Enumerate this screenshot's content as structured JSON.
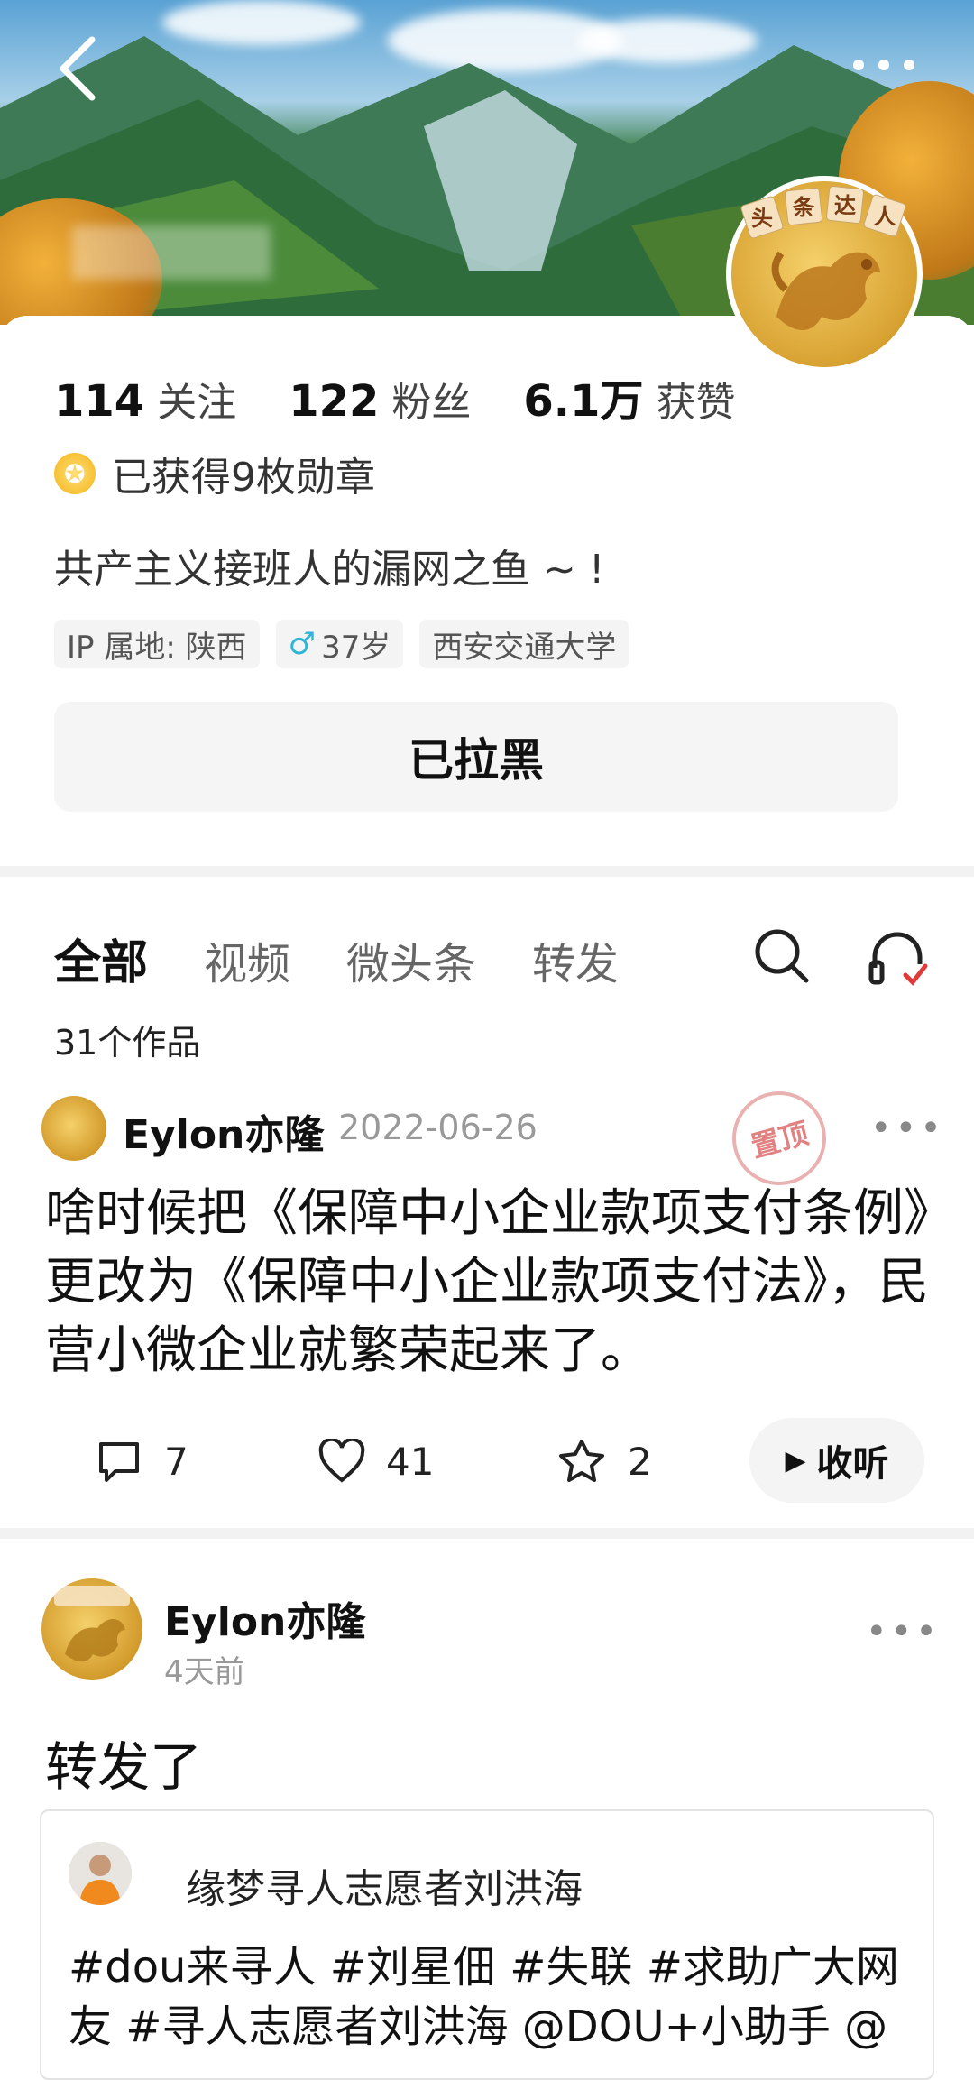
{
  "header": {
    "back_icon": "chevron-left-icon",
    "more_icon": "more-dots-icon",
    "avatar_badge_text": "头条达人"
  },
  "profile": {
    "stats": [
      {
        "num": "114",
        "label": "关注"
      },
      {
        "num": "122",
        "label": "粉丝"
      },
      {
        "num": "6.1万",
        "label": "获赞"
      }
    ],
    "badges_text": "已获得9枚勋章",
    "bio": "共产主义接班人的漏网之鱼 ~ !",
    "tags": [
      "IP 属地: 陕西",
      "37岁",
      "西安交通大学"
    ],
    "gender_icon": "male-icon",
    "blocked_label": "已拉黑"
  },
  "tabs": {
    "items": [
      "全部",
      "视频",
      "微头条",
      "转发"
    ],
    "active": "全部",
    "works_count": "31个作品"
  },
  "posts": [
    {
      "author": "Eylon亦隆",
      "date": "2022-06-26",
      "pin_label": "置顶",
      "text": "啥时候把《保障中小企业款项支付条例》更改为《保障中小企业款项支付法》，民营小微企业就繁荣起来了。",
      "comments": "7",
      "likes": "41",
      "favorites": "2",
      "listen_label": "收听"
    },
    {
      "author": "Eylon亦隆",
      "date": "4天前",
      "text": "转发了",
      "quote": {
        "author": "缘梦寻人志愿者刘洪海",
        "text": "#dou来寻人 #刘星佃 #失联 #求助广大网友 #寻人志愿者刘洪海 @DOU+小助手 @"
      }
    }
  ],
  "colors": {
    "accent_gold": "#d8a232",
    "pin_red": "#dc6d6d",
    "gender_blue": "#2fb5d8"
  }
}
